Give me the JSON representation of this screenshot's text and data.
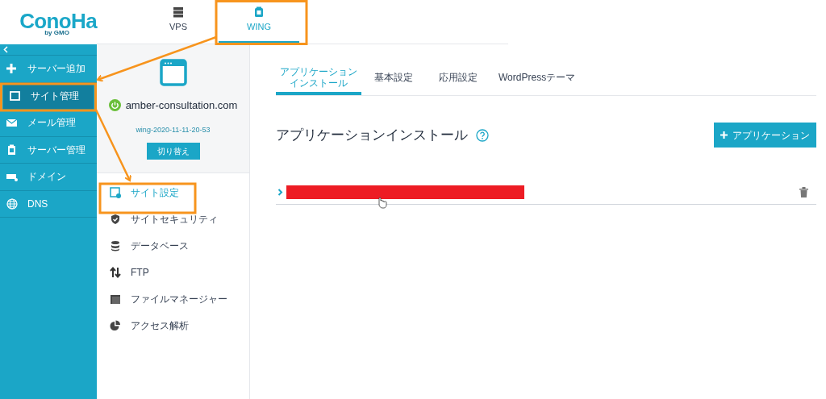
{
  "logo": {
    "text": "ConoHa",
    "sub": "by GMO"
  },
  "header_tabs": [
    {
      "label": "VPS",
      "selected": false
    },
    {
      "label": "WING",
      "selected": true
    }
  ],
  "sidebar": {
    "items": [
      {
        "label": "サーバー追加",
        "selected": false
      },
      {
        "label": "サイト管理",
        "selected": true
      },
      {
        "label": "メール管理",
        "selected": false
      },
      {
        "label": "サーバー管理",
        "selected": false
      },
      {
        "label": "ドメイン",
        "selected": false
      },
      {
        "label": "DNS",
        "selected": false
      }
    ]
  },
  "site_card": {
    "domain": "amber-consultation.com",
    "on": true,
    "server_id": "wing-2020-11-11-20-53",
    "button": "切り替え"
  },
  "site_menu": [
    {
      "label": "サイト設定",
      "selected": true
    },
    {
      "label": "サイトセキュリティ",
      "selected": false
    },
    {
      "label": "データベース",
      "selected": false
    },
    {
      "label": "FTP",
      "selected": false
    },
    {
      "label": "ファイルマネージャー",
      "selected": false
    },
    {
      "label": "アクセス解析",
      "selected": false
    }
  ],
  "content": {
    "tabs": [
      {
        "label": "アプリケーションインストール",
        "selected": true
      },
      {
        "label": "基本設定",
        "selected": false
      },
      {
        "label": "応用設定",
        "selected": false
      },
      {
        "label": "WordPressテーマ",
        "selected": false
      }
    ],
    "heading": "アプリケーションインストール",
    "add_button": "アプリケーション",
    "applications": [
      {
        "expanded": false
      }
    ]
  }
}
